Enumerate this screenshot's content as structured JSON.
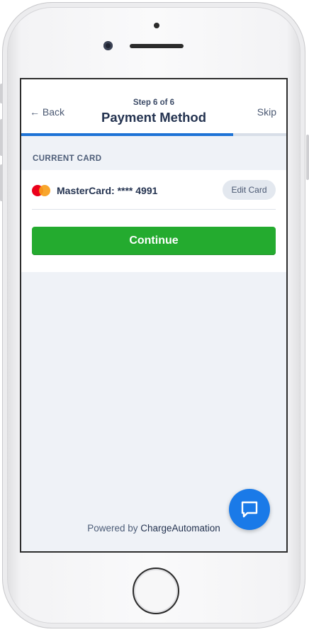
{
  "header": {
    "back_label": "← Back",
    "step_label": "Step 6 of 6",
    "title": "Payment Method",
    "skip_label": "Skip",
    "progress_fraction": 0.8
  },
  "current_card": {
    "section_label": "CURRENT CARD",
    "card_label": "MasterCard: **** 4991",
    "card_brand_icon": "mastercard-icon",
    "edit_label": "Edit Card"
  },
  "actions": {
    "continue_label": "Continue"
  },
  "footer": {
    "powered_prefix": "Powered by ",
    "brand_name": "ChargeAutomation"
  },
  "chat": {
    "icon": "chat-bubble-icon"
  },
  "colors": {
    "accent_blue": "#1e73d6",
    "continue_green": "#24ab2f",
    "background": "#eff2f7"
  }
}
